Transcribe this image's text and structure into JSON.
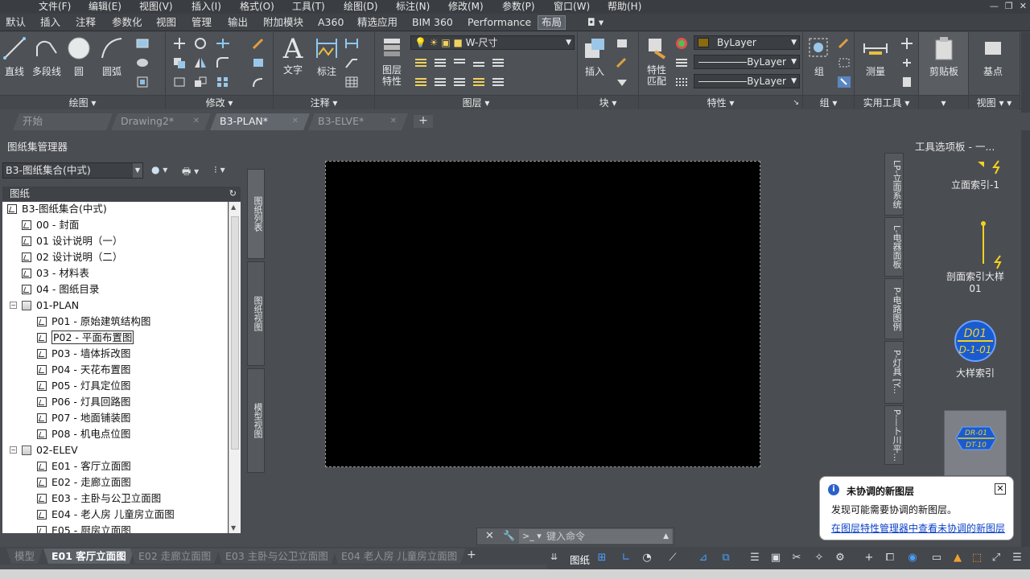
{
  "menu": [
    "文件(F)",
    "编辑(E)",
    "视图(V)",
    "插入(I)",
    "格式(O)",
    "工具(T)",
    "绘图(D)",
    "标注(N)",
    "修改(M)",
    "参数(P)",
    "窗口(W)",
    "帮助(H)"
  ],
  "ribbon_tabs": [
    "默认",
    "插入",
    "注释",
    "参数化",
    "视图",
    "管理",
    "输出",
    "附加模块",
    "A360",
    "精选应用",
    "BIM 360",
    "Performance",
    "布局"
  ],
  "ribbon_active_tab": "布局",
  "ribbon": {
    "draw": {
      "title": "绘图",
      "line": "直线",
      "polyline": "多段线",
      "circle": "圆",
      "arc": "圆弧"
    },
    "modify": {
      "title": "修改"
    },
    "annotation": {
      "title": "注释",
      "text": "文字",
      "dimension": "标注"
    },
    "layers": {
      "title": "图层",
      "layer_props": "图层\n特性",
      "layer_combo": "W-尺寸"
    },
    "block": {
      "title": "块",
      "insert": "插入"
    },
    "properties": {
      "title": "特性",
      "match": "特性\n匹配",
      "color": "ByLayer",
      "linetype": "ByLayer",
      "lineweight": "ByLayer"
    },
    "groups": {
      "title": "组",
      "group": "组"
    },
    "utilities": {
      "title": "实用工具",
      "measure": "测量"
    },
    "clipboard": {
      "title": "剪贴板"
    },
    "view": {
      "title": "视图",
      "base": "基点"
    }
  },
  "doc_tabs": [
    {
      "label": "开始",
      "active": false
    },
    {
      "label": "Drawing2*",
      "active": false
    },
    {
      "label": "B3-PLAN*",
      "active": true
    },
    {
      "label": "B3-ELVE*",
      "active": false
    }
  ],
  "sheet_set_manager": {
    "title": "图纸集管理器",
    "combo": "B3-图纸集合(中式)",
    "header": "图纸",
    "vtabs": [
      "图纸列表",
      "图纸视图",
      "模型视图"
    ],
    "tree": [
      {
        "label": "B3-图纸集合(中式)",
        "level": 0,
        "type": "root"
      },
      {
        "label": "00 - 封面",
        "level": 1,
        "type": "sheet"
      },
      {
        "label": "01 设计说明（一）",
        "level": 1,
        "type": "sheet"
      },
      {
        "label": "02 设计说明（二）",
        "level": 1,
        "type": "sheet"
      },
      {
        "label": "03 - 材料表",
        "level": 1,
        "type": "sheet"
      },
      {
        "label": "04 - 图纸目录",
        "level": 1,
        "type": "sheet"
      },
      {
        "label": "01-PLAN",
        "level": 1,
        "type": "subset"
      },
      {
        "label": "P01 - 原始建筑结构图",
        "level": 2,
        "type": "sheet"
      },
      {
        "label": "P02 - 平面布置图",
        "level": 2,
        "type": "sheet",
        "selected": true
      },
      {
        "label": "P03 - 墙体拆改图",
        "level": 2,
        "type": "sheet"
      },
      {
        "label": "P04 - 天花布置图",
        "level": 2,
        "type": "sheet"
      },
      {
        "label": "P05 - 灯具定位图",
        "level": 2,
        "type": "sheet"
      },
      {
        "label": "P06 - 灯具回路图",
        "level": 2,
        "type": "sheet"
      },
      {
        "label": "P07 - 地面铺装图",
        "level": 2,
        "type": "sheet"
      },
      {
        "label": "P08 - 机电点位图",
        "level": 2,
        "type": "sheet"
      },
      {
        "label": "02-ELEV",
        "level": 1,
        "type": "subset"
      },
      {
        "label": "E01 - 客厅立面图",
        "level": 2,
        "type": "sheet"
      },
      {
        "label": "E02 - 走廊立面图",
        "level": 2,
        "type": "sheet"
      },
      {
        "label": "E03 - 主卧与公卫立面图",
        "level": 2,
        "type": "sheet"
      },
      {
        "label": "E04 - 老人房 儿童房立面图",
        "level": 2,
        "type": "sheet"
      },
      {
        "label": "E05 - 厨房立面图",
        "level": 2,
        "type": "sheet"
      }
    ]
  },
  "tool_palette": {
    "title": "工具选项板 - 一...",
    "vtabs": [
      "LP-立面系统",
      "L-电器面板",
      "P-电路图例",
      "P-灯具 [Y...",
      "P-—卜川平..."
    ],
    "tools": [
      "立面索引-1",
      "剖面索引大样\n01",
      "大样索引"
    ],
    "symbol_top": "D01",
    "symbol_bottom": "D-1-01",
    "symbol2_top": "DR-01",
    "symbol2_bottom": "DT-10"
  },
  "notification": {
    "title": "未协调的新图层",
    "body": "发现可能需要协调的新图层。",
    "link": "在图层特性管理器中查看未协调的新图层"
  },
  "command_line": {
    "placeholder": "键入命令"
  },
  "layout_tabs": [
    {
      "label": "模型",
      "active": false
    },
    {
      "label": "E01 客厅立面图",
      "active": true
    },
    {
      "label": "E02 走廊立面图",
      "active": false
    },
    {
      "label": "E03 主卧与公卫立面图",
      "active": false
    },
    {
      "label": "E04 老人房 儿童房立面图",
      "active": false
    }
  ],
  "status": {
    "paper": "图纸"
  }
}
